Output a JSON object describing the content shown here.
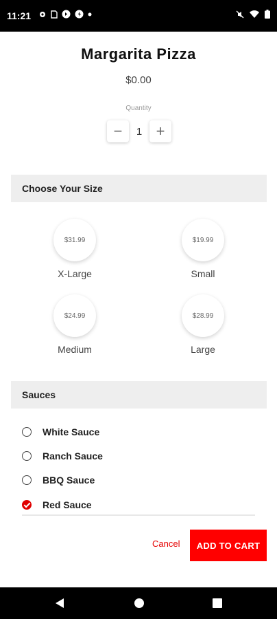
{
  "status_bar": {
    "time": "11:21"
  },
  "product": {
    "title": "Margarita Pizza",
    "price": "$0.00"
  },
  "quantity": {
    "label": "Quantity",
    "value": "1",
    "minus": "−",
    "plus": "+"
  },
  "sizes": {
    "header": "Choose Your Size",
    "options": [
      {
        "price": "$31.99",
        "label": "X-Large"
      },
      {
        "price": "$19.99",
        "label": "Small"
      },
      {
        "price": "$24.99",
        "label": "Medium"
      },
      {
        "price": "$28.99",
        "label": "Large"
      }
    ]
  },
  "sauces": {
    "header": "Sauces",
    "options": [
      {
        "label": "White Sauce",
        "checked": false
      },
      {
        "label": "Ranch Sauce",
        "checked": false
      },
      {
        "label": "BBQ Sauce",
        "checked": false
      },
      {
        "label": "Red Sauce",
        "checked": true
      }
    ]
  },
  "actions": {
    "cancel": "Cancel",
    "add_to_cart": "ADD TO CART"
  },
  "colors": {
    "accent": "#ff0000",
    "section_bg": "#eeeeee"
  }
}
